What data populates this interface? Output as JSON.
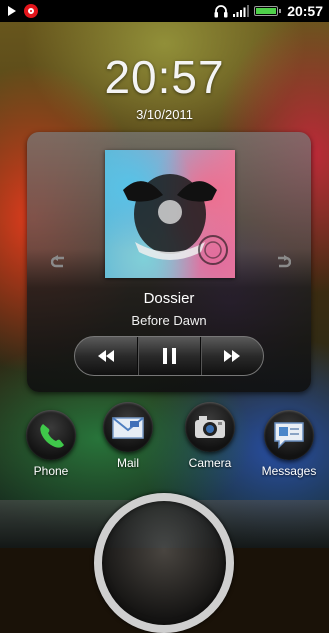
{
  "status_bar": {
    "time": "20:57",
    "icons": [
      "play-icon",
      "beats-audio-icon",
      "headset-icon",
      "signal-icon",
      "battery-icon"
    ],
    "battery_color": "#4fd14a"
  },
  "lockscreen": {
    "clock": "20:57",
    "date": "3/10/2011"
  },
  "music_widget": {
    "title": "Dossier",
    "artist": "Before Dawn",
    "controls": [
      "rewind-icon",
      "pause-icon",
      "fast-forward-icon"
    ]
  },
  "dock": [
    {
      "label": "Phone",
      "icon": "phone-icon"
    },
    {
      "label": "Mail",
      "icon": "mail-icon"
    },
    {
      "label": "Camera",
      "icon": "camera-icon"
    },
    {
      "label": "Messages",
      "icon": "messages-icon"
    }
  ]
}
